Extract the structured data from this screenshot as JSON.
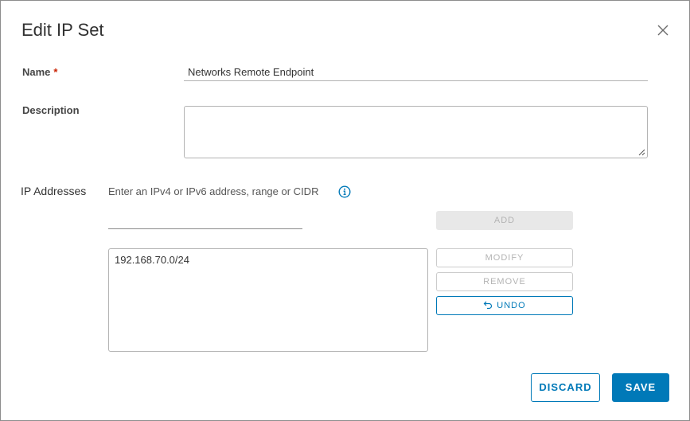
{
  "dialog": {
    "title": "Edit IP Set",
    "close_icon": "close-icon"
  },
  "form": {
    "name_label": "Name",
    "required_marker": "*",
    "name_value": "Networks Remote Endpoint",
    "description_label": "Description",
    "description_value": "",
    "ip_label": "IP Addresses",
    "ip_hint": "Enter an IPv4 or IPv6 address, range or CIDR",
    "ip_input_value": "",
    "info_icon": "info-icon",
    "ip_list": [
      "192.168.70.0/24"
    ]
  },
  "actions": {
    "add": "ADD",
    "modify": "MODIFY",
    "remove": "REMOVE",
    "undo": "UNDO",
    "undo_icon": "undo-icon",
    "discard": "DISCARD",
    "save": "SAVE"
  },
  "colors": {
    "accent": "#0079b8",
    "required": "#c92100",
    "disabled_text": "#b4b4b4",
    "disabled_bg": "#e8e8e8"
  }
}
